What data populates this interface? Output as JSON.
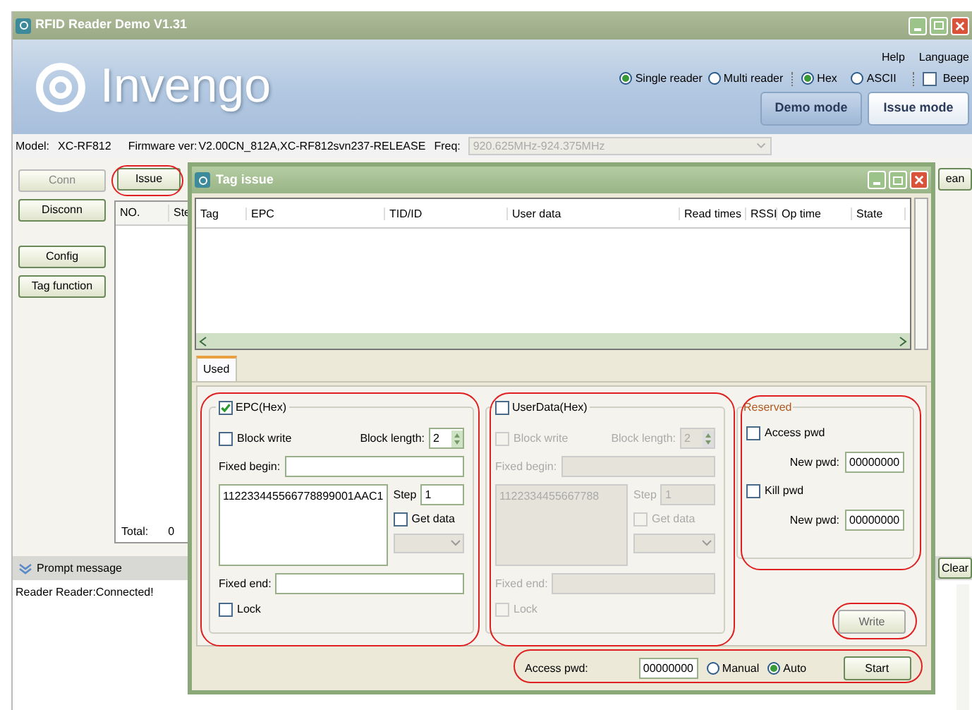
{
  "window": {
    "title": "RFID Reader Demo V1.31"
  },
  "header": {
    "logo": "Invengo",
    "menu": [
      "Help",
      "Language"
    ],
    "reader_modes": [
      {
        "label": "Single reader",
        "selected": true
      },
      {
        "label": "Multi reader",
        "selected": false
      }
    ],
    "encodings": [
      {
        "label": "Hex",
        "selected": true
      },
      {
        "label": "ASCII",
        "selected": false
      }
    ],
    "beep": {
      "label": "Beep",
      "checked": false
    },
    "mode_buttons": [
      {
        "label": "Demo mode",
        "selected": false
      },
      {
        "label": "Issue mode",
        "selected": true
      }
    ]
  },
  "info": {
    "model_label": "Model:",
    "model": "XC-RF812",
    "firmware_label": "Firmware ver:",
    "firmware": "V2.00CN_812A,XC-RF812svn237-RELEASE",
    "freq_label": "Freq:",
    "freq": "920.625MHz-924.375MHz"
  },
  "side_buttons": [
    {
      "label": "Conn",
      "disabled": true
    },
    {
      "label": "Disconn",
      "disabled": false
    },
    {
      "label": "Config",
      "disabled": false
    },
    {
      "label": "Tag function",
      "disabled": false
    }
  ],
  "toolbar": {
    "issue_button": "Issue",
    "right_button": "ean",
    "clear_button": "Clear"
  },
  "main_table": {
    "columns": [
      "NO.",
      "Ste"
    ],
    "total_label": "Total:",
    "total": "0"
  },
  "prompt": {
    "title": "Prompt message",
    "messages": [
      "Reader Reader:Connected!"
    ]
  },
  "dialog": {
    "title": "Tag issue",
    "table": {
      "columns": [
        "Tag",
        "EPC",
        "TID/ID",
        "User data",
        "Read times",
        "RSSI",
        "Op time",
        "State"
      ]
    },
    "tabs": [
      {
        "label": "Used",
        "selected": true
      }
    ],
    "groups": [
      {
        "title": "EPC(Hex)",
        "checked": true,
        "disabled": false,
        "block_write": {
          "label": "Block write",
          "checked": false
        },
        "block_length_label": "Block length:",
        "block_length": "2",
        "fixed_begin_label": "Fixed begin:",
        "data": "112233445566778899001AAC1",
        "step_label": "Step",
        "step": "1",
        "get_data": {
          "label": "Get data",
          "checked": false
        },
        "fixed_end_label": "Fixed end:",
        "lock": {
          "label": "Lock",
          "checked": false
        }
      },
      {
        "title": "UserData(Hex)",
        "checked": false,
        "disabled": true,
        "block_write": {
          "label": "Block write",
          "checked": false
        },
        "block_length_label": "Block length:",
        "block_length": "2",
        "fixed_begin_label": "Fixed begin:",
        "data": "1122334455667788",
        "step_label": "Step",
        "step": "1",
        "get_data": {
          "label": "Get data",
          "checked": false
        },
        "fixed_end_label": "Fixed end:",
        "lock": {
          "label": "Lock",
          "checked": false
        }
      }
    ],
    "reserved": {
      "title": "Reserved",
      "access_pwd": {
        "label": "Access pwd",
        "checked": false
      },
      "access_new_label": "New pwd:",
      "access_new": "00000000",
      "kill_pwd": {
        "label": "Kill pwd",
        "checked": false
      },
      "kill_new_label": "New pwd:",
      "kill_new": "00000000"
    },
    "write_button": "Write",
    "footer": {
      "access_label": "Access pwd:",
      "access_value": "00000000",
      "modes": [
        {
          "label": "Manual",
          "selected": false
        },
        {
          "label": "Auto",
          "selected": true
        }
      ],
      "start_button": "Start"
    }
  }
}
